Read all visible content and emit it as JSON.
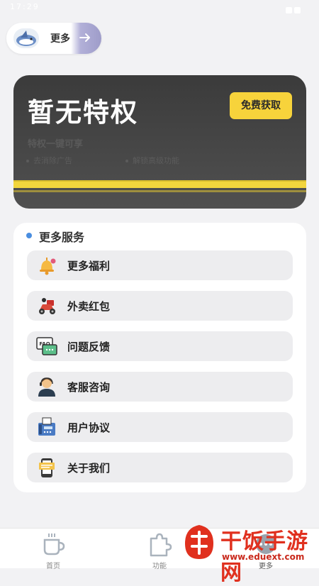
{
  "status_bar": {
    "time": "17:29"
  },
  "header": {
    "more_label": "更多"
  },
  "privilege_card": {
    "title": "暂无特权",
    "claim_button": "免费获取",
    "subtitle": "特权一键可享",
    "bullets": [
      "去消除广告",
      "解锁高级功能"
    ]
  },
  "services": {
    "title": "更多服务",
    "items": [
      {
        "label": "更多福利",
        "icon": "bell-icon"
      },
      {
        "label": "外卖红包",
        "icon": "scooter-icon"
      },
      {
        "label": "问题反馈",
        "icon": "faq-icon"
      },
      {
        "label": "客服咨询",
        "icon": "support-agent-icon"
      },
      {
        "label": "用户协议",
        "icon": "fax-phone-icon"
      },
      {
        "label": "关于我们",
        "icon": "phone-info-icon"
      }
    ]
  },
  "bottom_nav": {
    "items": [
      {
        "label": "首页",
        "icon": "coffee-cup-icon",
        "active": false
      },
      {
        "label": "功能",
        "icon": "puzzle-icon",
        "active": false
      },
      {
        "label": "更多",
        "icon": "more-icon",
        "active": true
      }
    ]
  },
  "watermark": {
    "name": "干饭手游网",
    "url": "www.eduext.com"
  },
  "colors": {
    "accent_yellow": "#f7d33b",
    "card_dark": "#3b3b3b",
    "dot_blue": "#4a8ee0",
    "watermark_red": "#e0301e"
  }
}
